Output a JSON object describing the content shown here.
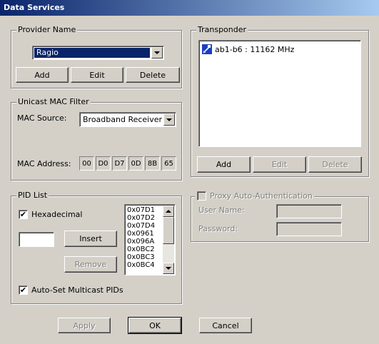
{
  "window": {
    "title": "Data Services"
  },
  "provider": {
    "group_label": "Provider Name",
    "selected": "Ragio",
    "add_label": "Add",
    "edit_label": "Edit",
    "delete_label": "Delete"
  },
  "transponder": {
    "group_label": "Transponder",
    "items": [
      {
        "label": "ab1-b6 : 11162 MHz"
      }
    ],
    "add_label": "Add",
    "edit_label": "Edit",
    "delete_label": "Delete"
  },
  "mac_filter": {
    "group_label": "Unicast MAC Filter",
    "source_label": "MAC Source:",
    "source_value": "Broadband Receiver",
    "address_label": "MAC Address:",
    "address_octets": [
      "00",
      "D0",
      "D7",
      "0D",
      "8B",
      "65"
    ]
  },
  "pid_list": {
    "group_label": "PID List",
    "hexadecimal_label": "Hexadecimal",
    "hexadecimal_checked": true,
    "input_value": "",
    "insert_label": "Insert",
    "remove_label": "Remove",
    "items": [
      "0x07D1",
      "0x07D2",
      "0x07D4",
      "0x0961",
      "0x096A",
      "0x0BC2",
      "0x0BC3",
      "0x0BC4"
    ],
    "auto_set_label": "Auto-Set Multicast PIDs",
    "auto_set_checked": true
  },
  "proxy": {
    "auth_label": "Proxy Auto-Authentication",
    "auth_checked": false,
    "username_label": "User Name:",
    "password_label": "Password:",
    "username_value": "",
    "password_value": ""
  },
  "footer": {
    "apply_label": "Apply",
    "ok_label": "OK",
    "cancel_label": "Cancel"
  },
  "icons": {
    "transponder_item_icon": "satellite-link-icon",
    "dropdown_icon": "chevron-down-icon",
    "checkbox_mark": "✔"
  },
  "colors": {
    "titlebar_start": "#0a246a",
    "titlebar_end": "#a6caf0",
    "selection": "#0a246a",
    "face": "#d4d0c8"
  }
}
